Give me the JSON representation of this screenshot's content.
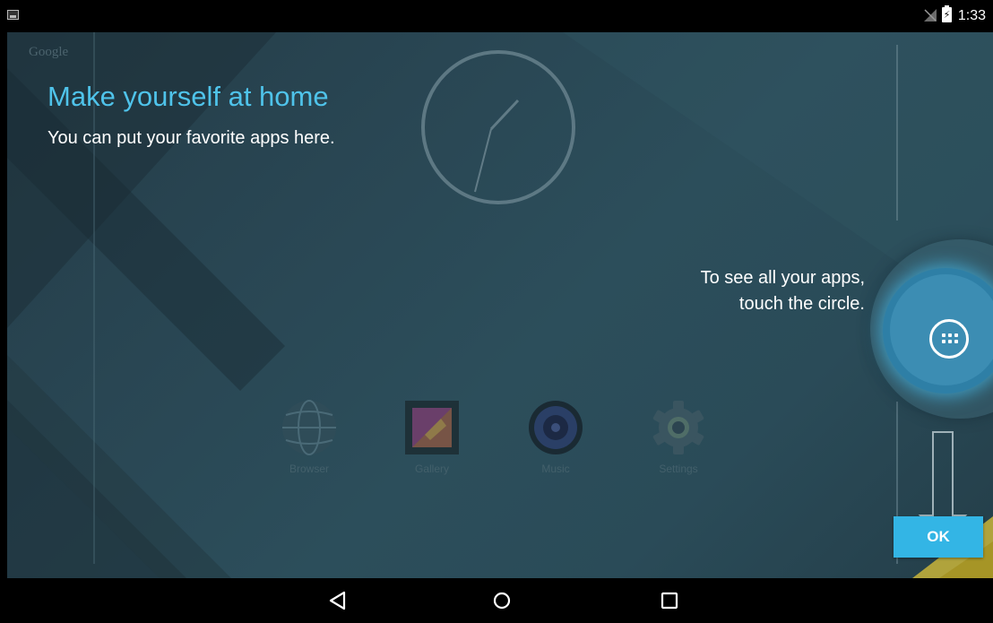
{
  "status_bar": {
    "time": "1:33",
    "left_icon": "image-notification-icon",
    "signal_icon": "no-signal-icon",
    "battery_icon": "battery-charging-icon"
  },
  "home": {
    "google_text": "Google",
    "clock_icon": "analog-clock-widget"
  },
  "cling": {
    "headline": "Make yourself at home",
    "subline": "You can put your favorite apps here.",
    "hint": "To see all your apps, touch the circle.",
    "ok_label": "OK",
    "all_apps_icon": "all-apps-icon"
  },
  "hotseat": [
    {
      "label": "Browser",
      "icon": "browser-globe-icon"
    },
    {
      "label": "Gallery",
      "icon": "gallery-icon"
    },
    {
      "label": "Music",
      "icon": "music-speaker-icon"
    },
    {
      "label": "Settings",
      "icon": "settings-gear-icon"
    }
  ],
  "nav_bar": {
    "back_icon": "back-icon",
    "home_icon": "home-icon",
    "recents_icon": "recents-icon"
  },
  "colors": {
    "accent": "#33b5e5",
    "headline": "#4fc3ea",
    "glow": "#2e7fa6"
  }
}
